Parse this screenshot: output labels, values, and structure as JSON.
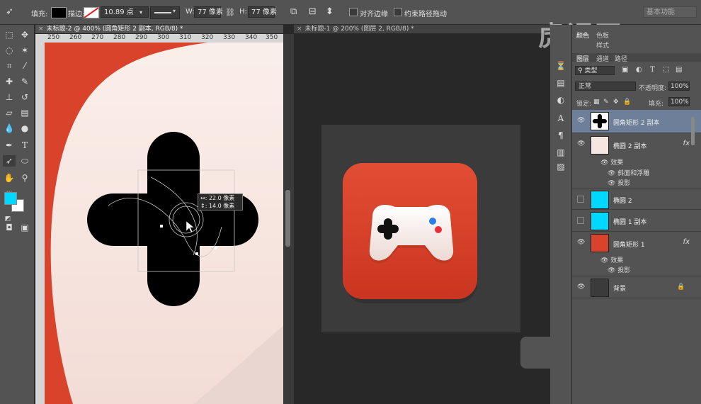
{
  "options_bar": {
    "fill_label": "填充:",
    "stroke_label": "描边:",
    "stroke_width": "10.89 点",
    "w_label": "W:",
    "w_value": "77 像素",
    "h_label": "H:",
    "h_value": "77 像素",
    "align_edges": "对齐边缘",
    "constrain_path": "约束路径拖动",
    "workspace": "基本功能",
    "fill_color": "#000000"
  },
  "tabs": [
    {
      "label": "未标题-2 @ 400% (圆角矩形 2 副本, RGB/8) *",
      "active": true
    },
    {
      "label": "未标题-1 @ 200% (图层 2, RGB/8) *",
      "active": false
    }
  ],
  "ruler": {
    "ticks": [
      "250",
      "260",
      "270",
      "280",
      "290",
      "300",
      "310",
      "320",
      "330",
      "340",
      "350"
    ]
  },
  "tooltip": {
    "line1": "↔: 22.0 像素",
    "line2": "↕: 14.0 像素"
  },
  "colors": {
    "foreground": "#00d8ff",
    "background": "#ffffff",
    "app_red": "#d9432c",
    "layer_selected": "#6d7f99"
  },
  "watermark": "虎课网",
  "panels": {
    "top_tabs": [
      "颜色",
      "色板",
      "样式"
    ],
    "layer_tabs": [
      "图层",
      "通道",
      "路径"
    ],
    "filter_kind": "类型",
    "blend_mode": "正常",
    "opacity_label": "不透明度:",
    "opacity_value": "100%",
    "lock_label": "锁定:",
    "fill_label": "填充:",
    "fill_value": "100%"
  },
  "layers": [
    {
      "name": "圆角矩形 2 副本",
      "selected": true,
      "visible": true
    },
    {
      "name": "椭圆 2 副本",
      "selected": false,
      "visible": true,
      "fx": "fx",
      "effects_label": "效果",
      "effects": [
        "斜面和浮雕",
        "投影"
      ]
    },
    {
      "name": "椭圆 2",
      "selected": false,
      "visible": false
    },
    {
      "name": "椭圆 1 副本",
      "selected": false,
      "visible": false
    },
    {
      "name": "圆角矩形 1",
      "selected": false,
      "visible": true,
      "fx": "fx",
      "effects_label": "效果",
      "effects": [
        "投影"
      ]
    },
    {
      "name": "背景",
      "selected": false,
      "visible": true
    }
  ]
}
